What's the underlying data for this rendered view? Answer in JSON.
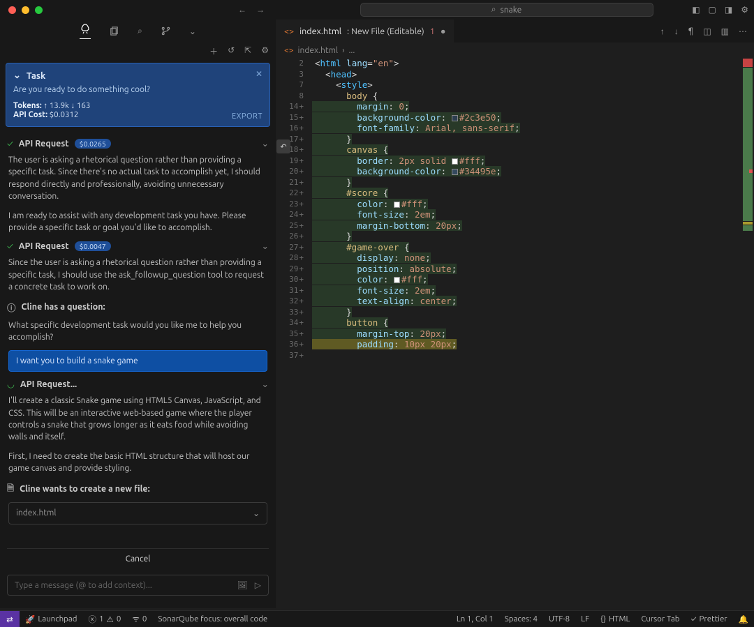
{
  "title": {
    "search_placeholder": "snake"
  },
  "tab": {
    "file": "index.html",
    "suffix": ": New File (Editable)",
    "count": "1",
    "mod": "●"
  },
  "breadcrumb": {
    "a": "index.html",
    "b": "..."
  },
  "task": {
    "title": "Task",
    "question": "Are you ready to do something cool?",
    "tokens_label": "Tokens:",
    "tokens_up": "13.9k",
    "tokens_down": "163",
    "cost_label": "API Cost:",
    "cost": "$0.0312",
    "export": "EXPORT"
  },
  "req1": {
    "label": "API Request",
    "cost": "$0.0265"
  },
  "req1_para": "The user is asking a rhetorical question rather than providing a specific task. Since there's no actual task to accomplish yet, I should respond directly and professionally, avoiding unnecessary conversation.",
  "req1_para2": "I am ready to assist with any development task you have. Please provide a specific task or goal you'd like to accomplish.",
  "req2": {
    "label": "API Request",
    "cost": "$0.0047"
  },
  "req2_para": "Since the user is asking a rhetorical question rather than providing a specific task, I should use the ask_followup_question tool to request a concrete task to work on.",
  "cline_q": "Cline has a question:",
  "cline_q_body": "What specific development task would you like me to help you accomplish?",
  "user_reply": "I want you to build a snake game",
  "req3": {
    "label": "API Request..."
  },
  "req3_para": "I'll create a classic Snake game using HTML5 Canvas, JavaScript, and CSS. This will be an interactive web-based game where the player controls a snake that grows longer as it eats food while avoiding walls and itself.",
  "req3_para2": "First, I need to create the basic HTML structure that will host our game canvas and provide styling.",
  "newfile": {
    "label": "Cline wants to create a new file:",
    "name": "index.html"
  },
  "cancel": "Cancel",
  "msg_placeholder": "Type a message (@ to add context)...",
  "code": [
    {
      "n": "2",
      "p": "",
      "t": [
        [
          "pun",
          "<"
        ],
        [
          "tag",
          "html "
        ],
        [
          "attr",
          "lang"
        ],
        [
          "pun",
          "="
        ],
        [
          "str",
          "\"en\""
        ],
        [
          "pun",
          ">"
        ]
      ]
    },
    {
      "n": "3",
      "p": "",
      "t": [
        [
          "pun",
          "  <"
        ],
        [
          "tag",
          "head"
        ],
        [
          "pun",
          ">"
        ]
      ]
    },
    {
      "n": "7",
      "p": "",
      "t": [
        [
          "pun",
          "    <"
        ],
        [
          "tag",
          "style"
        ],
        [
          "pun",
          ">"
        ]
      ]
    },
    {
      "n": "8",
      "p": "",
      "t": [
        [
          "sel",
          "      body "
        ],
        [
          "pun",
          "{"
        ]
      ]
    },
    {
      "n": "14",
      "p": "+",
      "g": 1,
      "t": [
        [
          "prop",
          "        margin"
        ],
        [
          "pun",
          ": "
        ],
        [
          "val",
          "0"
        ],
        [
          "pun",
          ";"
        ]
      ]
    },
    {
      "n": "15",
      "p": "+",
      "g": 1,
      "t": [
        [
          "prop",
          "        background-color"
        ],
        [
          "pun",
          ": "
        ],
        [
          "sw",
          "#2c3e50"
        ],
        [
          "val",
          "#2c3e50"
        ],
        [
          "pun",
          ";"
        ]
      ]
    },
    {
      "n": "16",
      "p": "+",
      "g": 1,
      "t": [
        [
          "prop",
          "        font-family"
        ],
        [
          "pun",
          ": "
        ],
        [
          "val",
          "Arial, sans-serif"
        ],
        [
          "pun",
          ";"
        ]
      ]
    },
    {
      "n": "17",
      "p": "+",
      "g": 1,
      "t": [
        [
          "pun",
          "      }"
        ]
      ]
    },
    {
      "n": "18",
      "p": "+",
      "g": 1,
      "t": [
        [
          "sel",
          "      canvas "
        ],
        [
          "pun",
          "{"
        ]
      ]
    },
    {
      "n": "19",
      "p": "+",
      "g": 1,
      "t": [
        [
          "prop",
          "        border"
        ],
        [
          "pun",
          ": "
        ],
        [
          "val",
          "2px solid "
        ],
        [
          "sw",
          "#fff"
        ],
        [
          "val",
          "#fff"
        ],
        [
          "pun",
          ";"
        ]
      ]
    },
    {
      "n": "20",
      "p": "+",
      "g": 1,
      "t": [
        [
          "prop",
          "        background-color"
        ],
        [
          "pun",
          ": "
        ],
        [
          "sw",
          "#34495e"
        ],
        [
          "val",
          "#34495e"
        ],
        [
          "pun",
          ";"
        ]
      ]
    },
    {
      "n": "21",
      "p": "+",
      "g": 1,
      "t": [
        [
          "pun",
          "      }"
        ]
      ]
    },
    {
      "n": "22",
      "p": "+",
      "g": 1,
      "t": [
        [
          "sel",
          "      #score "
        ],
        [
          "pun",
          "{"
        ]
      ]
    },
    {
      "n": "23",
      "p": "+",
      "g": 1,
      "t": [
        [
          "prop",
          "        color"
        ],
        [
          "pun",
          ": "
        ],
        [
          "sw",
          "#fff"
        ],
        [
          "val",
          "#fff"
        ],
        [
          "pun",
          ";"
        ]
      ]
    },
    {
      "n": "24",
      "p": "+",
      "g": 1,
      "t": [
        [
          "prop",
          "        font-size"
        ],
        [
          "pun",
          ": "
        ],
        [
          "val",
          "2em"
        ],
        [
          "pun",
          ";"
        ]
      ]
    },
    {
      "n": "25",
      "p": "+",
      "g": 1,
      "t": [
        [
          "prop",
          "        margin-bottom"
        ],
        [
          "pun",
          ": "
        ],
        [
          "val",
          "20px"
        ],
        [
          "pun",
          ";"
        ]
      ]
    },
    {
      "n": "26",
      "p": "+",
      "g": 1,
      "t": [
        [
          "pun",
          "      }"
        ]
      ]
    },
    {
      "n": "27",
      "p": "+",
      "g": 1,
      "t": [
        [
          "sel",
          "      #game-over "
        ],
        [
          "pun",
          "{"
        ]
      ]
    },
    {
      "n": "28",
      "p": "+",
      "g": 1,
      "t": [
        [
          "prop",
          "        display"
        ],
        [
          "pun",
          ": "
        ],
        [
          "val",
          "none"
        ],
        [
          "pun",
          ";"
        ]
      ]
    },
    {
      "n": "29",
      "p": "+",
      "g": 1,
      "t": [
        [
          "prop",
          "        position"
        ],
        [
          "pun",
          ": "
        ],
        [
          "val",
          "absolute"
        ],
        [
          "pun",
          ";"
        ]
      ]
    },
    {
      "n": "30",
      "p": "+",
      "g": 1,
      "t": [
        [
          "prop",
          "        color"
        ],
        [
          "pun",
          ": "
        ],
        [
          "sw",
          "#fff"
        ],
        [
          "val",
          "#fff"
        ],
        [
          "pun",
          ";"
        ]
      ]
    },
    {
      "n": "31",
      "p": "+",
      "g": 1,
      "t": [
        [
          "prop",
          "        font-size"
        ],
        [
          "pun",
          ": "
        ],
        [
          "val",
          "2em"
        ],
        [
          "pun",
          ";"
        ]
      ]
    },
    {
      "n": "32",
      "p": "+",
      "g": 1,
      "t": [
        [
          "prop",
          "        text-align"
        ],
        [
          "pun",
          ": "
        ],
        [
          "val",
          "center"
        ],
        [
          "pun",
          ";"
        ]
      ]
    },
    {
      "n": "33",
      "p": "+",
      "g": 1,
      "t": [
        [
          "pun",
          "      }"
        ]
      ]
    },
    {
      "n": "34",
      "p": "+",
      "g": 1,
      "t": [
        [
          "sel",
          "      button "
        ],
        [
          "pun",
          "{"
        ]
      ]
    },
    {
      "n": "35",
      "p": "+",
      "g": 1,
      "t": [
        [
          "prop",
          "        margin-top"
        ],
        [
          "pun",
          ": "
        ],
        [
          "val",
          "20px"
        ],
        [
          "pun",
          ";"
        ]
      ]
    },
    {
      "n": "36",
      "p": "+",
      "y": 1,
      "t": [
        [
          "prop",
          "        padding"
        ],
        [
          "pun",
          ": "
        ],
        [
          "val",
          "10px 20px"
        ],
        [
          "pun",
          ";"
        ]
      ]
    },
    {
      "n": "37",
      "p": "+",
      "g": 1,
      "t": [
        [
          "pun",
          ""
        ]
      ]
    }
  ],
  "status": {
    "launchpad": "Launchpad",
    "err": "1",
    "warn": "0",
    "ports": "0",
    "sonar": "SonarQube focus: overall code",
    "lncol": "Ln 1, Col 1",
    "spaces": "Spaces: 4",
    "enc": "UTF-8",
    "eol": "LF",
    "lang": "HTML",
    "cursor": "Cursor Tab",
    "prettier": "Prettier"
  }
}
